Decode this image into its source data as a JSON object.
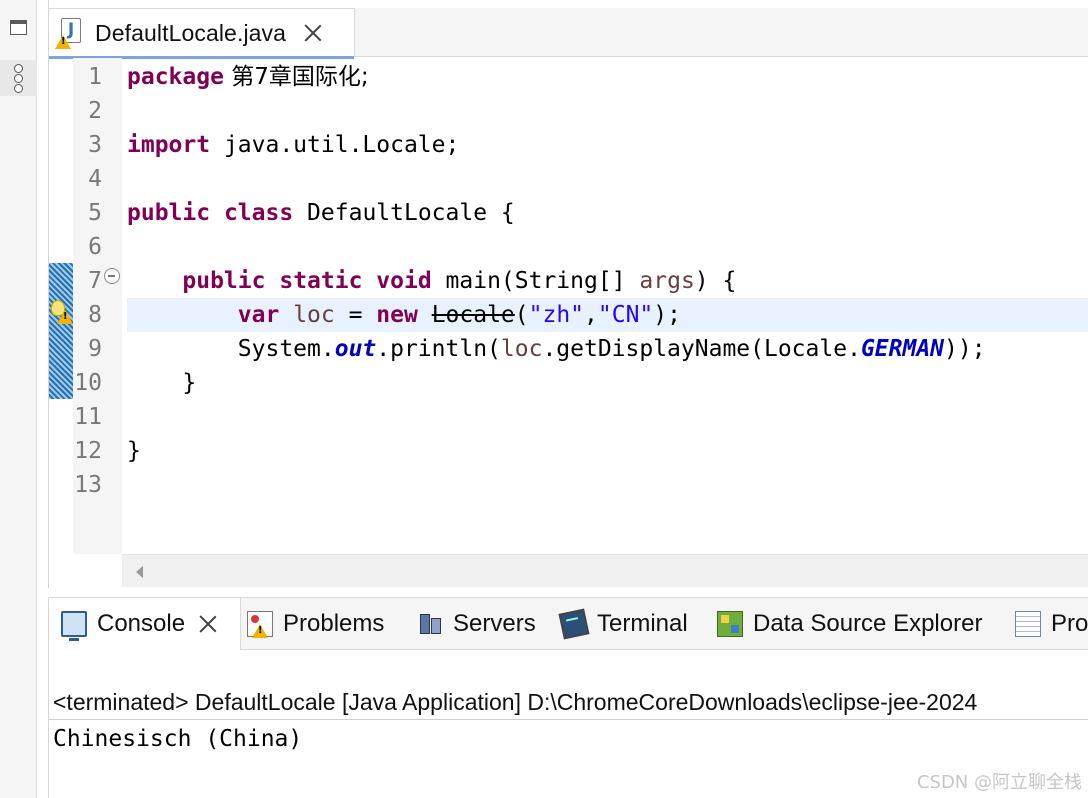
{
  "left_trim": {
    "restore_icon": "restore-window-icon",
    "views_icon": "trimmed-views-icon"
  },
  "editor": {
    "tab": {
      "title": "DefaultLocale.java",
      "icon": "java-file-warning-icon",
      "close_icon": "close-icon"
    },
    "line_numbers": [
      "1",
      "2",
      "3",
      "4",
      "5",
      "6",
      "7",
      "8",
      "9",
      "10",
      "11",
      "12",
      "13"
    ],
    "current_line": 8,
    "code": {
      "line1": {
        "kw": "package",
        "rest": " 第7章国际化;"
      },
      "line3": {
        "kw": "import",
        "rest": " java.util.Locale;"
      },
      "line5": {
        "kw1": "public",
        "kw2": "class",
        "rest": " DefaultLocale {"
      },
      "line7": {
        "indent": "    ",
        "kw1": "public",
        "kw2": "static",
        "kw3": "void",
        "mid": " main(String[] ",
        "arg": "args",
        "end": ") {"
      },
      "line8": {
        "indent": "        ",
        "kw1": "var",
        "var": "loc",
        "eq": " = ",
        "kw2": "new",
        "deprecated": "Locale",
        "open": "(",
        "s1": "\"zh\"",
        "comma": ",",
        "s2": "\"CN\"",
        "close": ");"
      },
      "line9": {
        "indent": "        ",
        "p1": "System.",
        "field1": "out",
        "p2": ".println(",
        "var": "loc",
        "p3": ".getDisplayName(Locale.",
        "field2": "GERMAN",
        "p4": "));"
      },
      "line10": {
        "text": "    }"
      },
      "line12": {
        "text": "}"
      }
    }
  },
  "bottom_panel": {
    "tabs": [
      {
        "label": "Console",
        "icon": "console-icon",
        "active": true
      },
      {
        "label": "Problems",
        "icon": "problems-icon"
      },
      {
        "label": "Servers",
        "icon": "servers-icon"
      },
      {
        "label": "Terminal",
        "icon": "terminal-icon"
      },
      {
        "label": "Data Source Explorer",
        "icon": "data-source-explorer-icon"
      },
      {
        "label": "Pro",
        "icon": "properties-icon"
      }
    ],
    "console_header": "<terminated> DefaultLocale [Java Application] D:\\ChromeCoreDownloads\\eclipse-jee-2024",
    "console_output": "Chinesisch (China)"
  },
  "watermark": "CSDN @阿立聊全栈",
  "colors": {
    "keyword": "#7f0055",
    "string": "#2a00ff",
    "field": "#0000c0",
    "local_var": "#6a3e3e",
    "current_line": "#e8f2fe",
    "tab_underline": "#7ba4d8"
  }
}
